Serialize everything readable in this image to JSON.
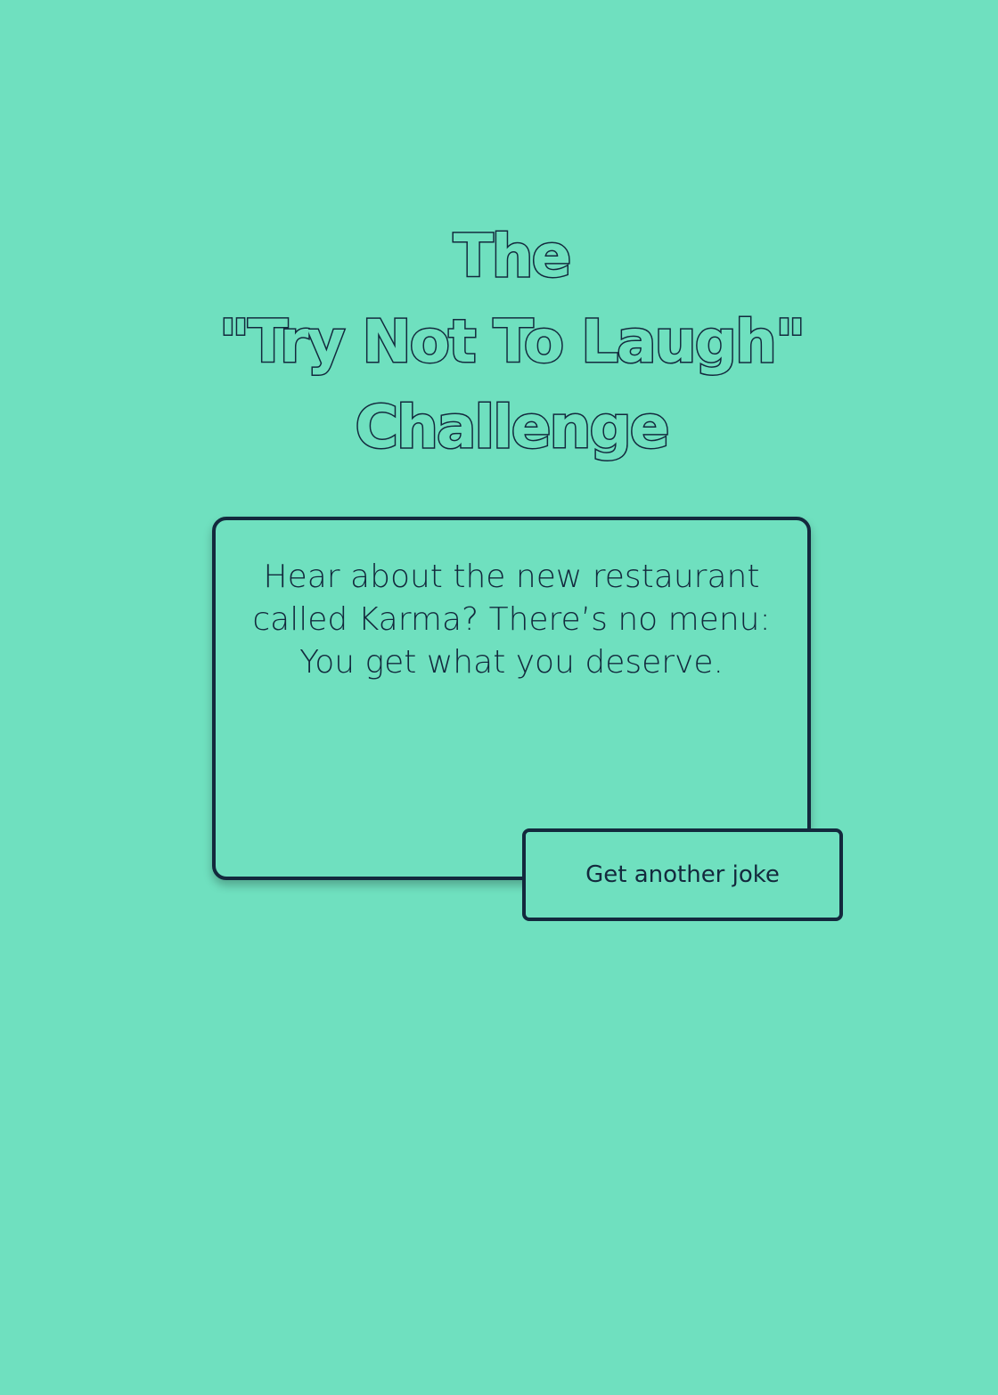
{
  "title": {
    "line1": "The",
    "line2": "\"Try Not To Laugh\"",
    "line3": "Challenge"
  },
  "joke": {
    "text": "Hear about the new restaurant called Karma? There’s no menu: You get what you deserve."
  },
  "button": {
    "label": "Get another joke"
  },
  "colors": {
    "background": "#6fe0bf",
    "outline": "#13293d"
  }
}
